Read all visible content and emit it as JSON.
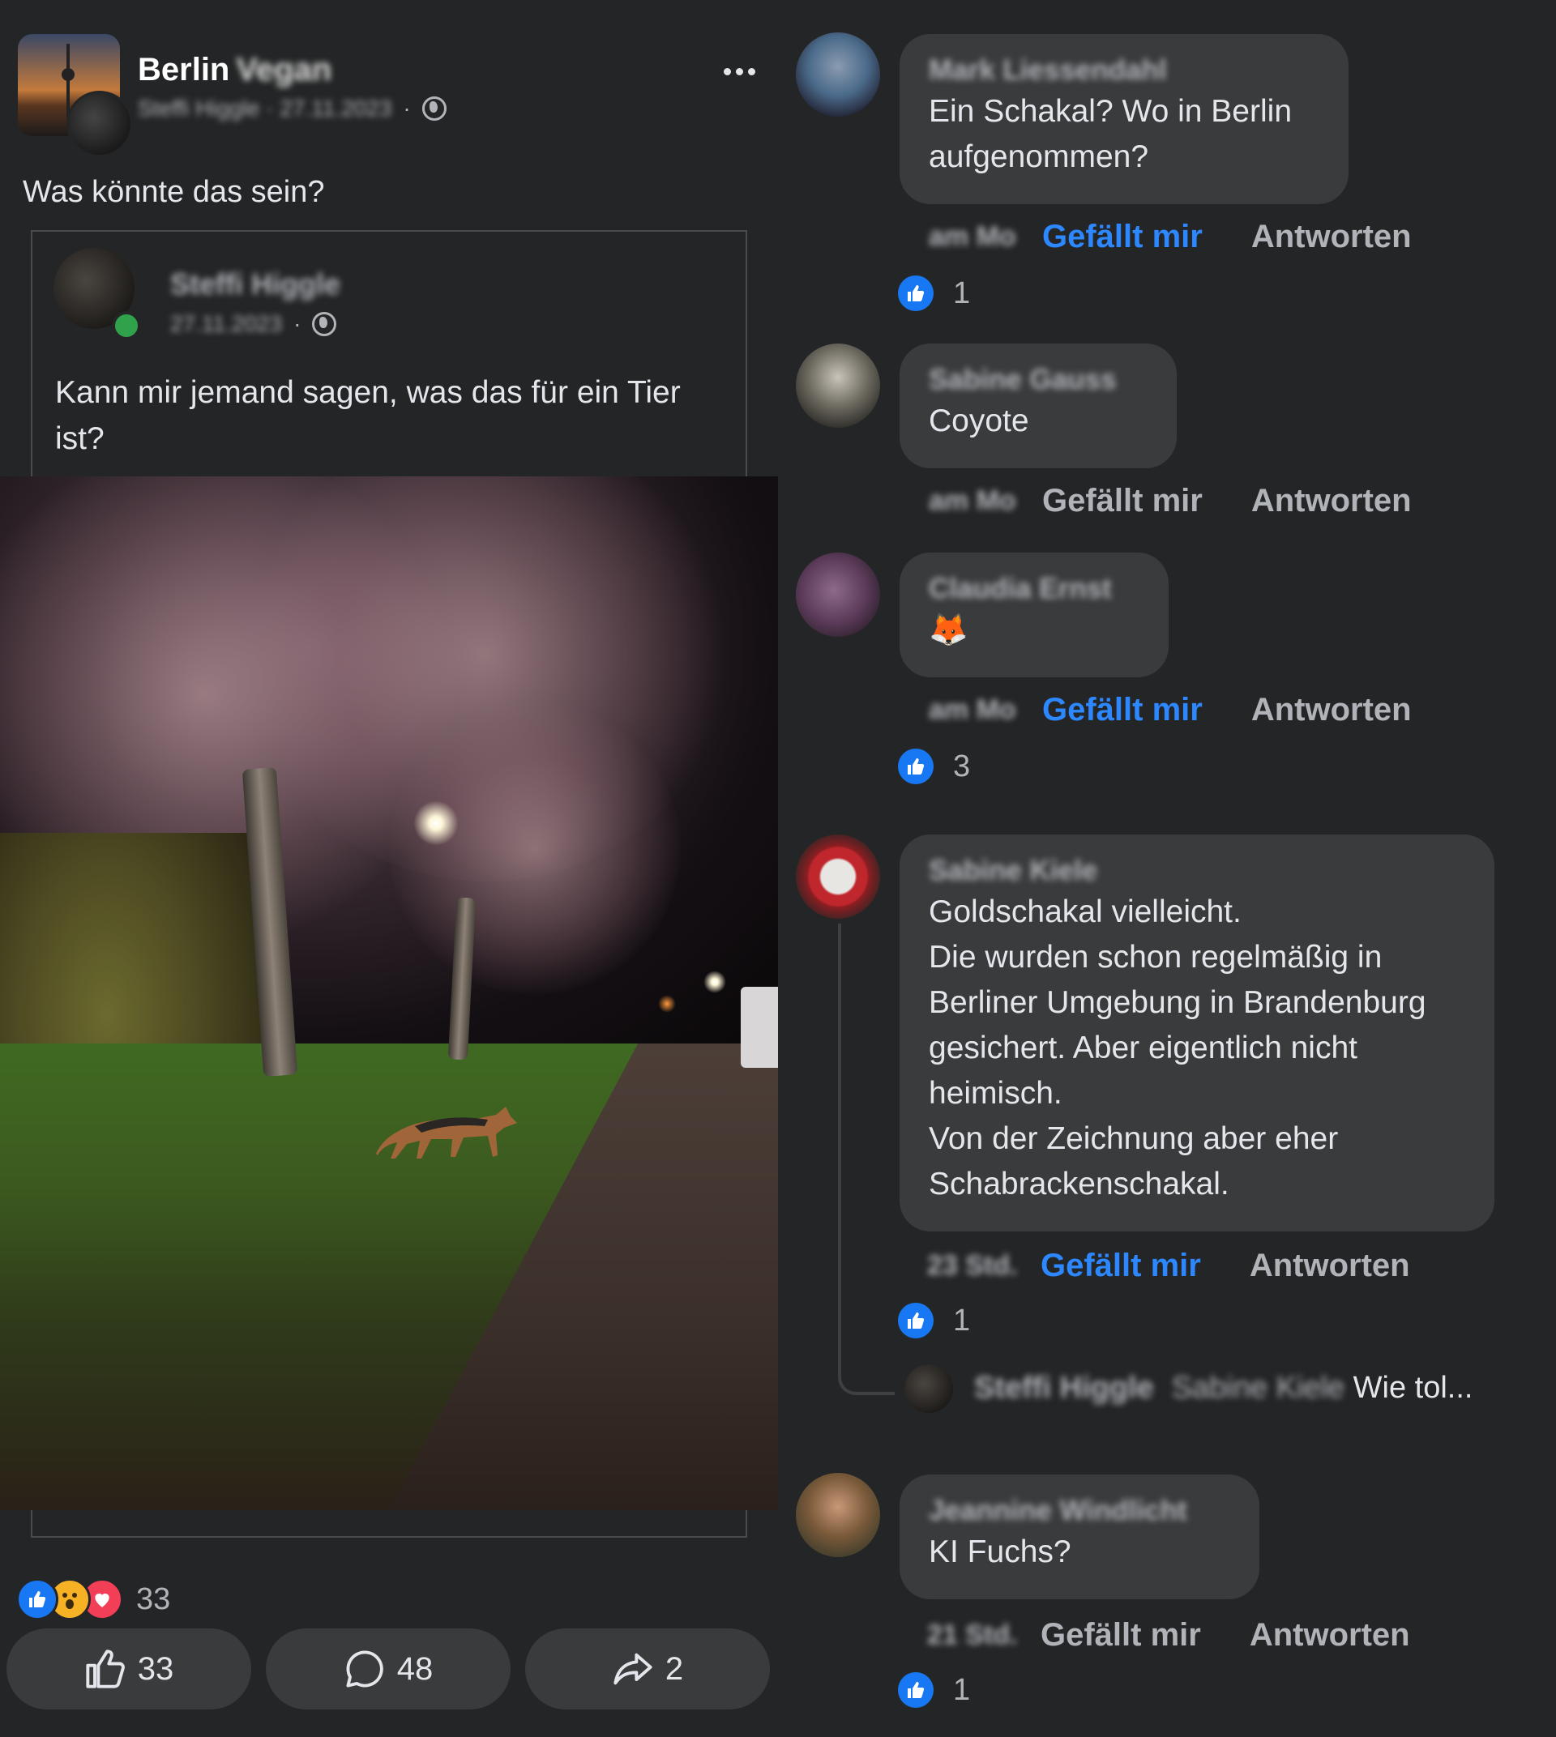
{
  "post": {
    "group_name": "Berlin",
    "group_name_blurred": "Vegan",
    "meta_blurred": "Steffi Higgle · 27.11.2023",
    "meta_dot": "·",
    "text": "Was könnte das sein?",
    "shared": {
      "author_blurred": "Steffi Higgle",
      "date_blurred": "27.11.2023",
      "meta_dot": "·",
      "text": "Kann mir jemand sagen, was das für ein Tier ist?"
    },
    "reactions_count": "33",
    "actions": {
      "like_count": "33",
      "comment_count": "48",
      "share_count": "2"
    }
  },
  "comments": [
    {
      "author_blurred": "Mark Liessendahl",
      "text": "Ein Schakal? Wo in Berlin aufgenommen?",
      "time_blurred": "am Mo",
      "like_label": "Gefällt mir",
      "reply_label": "Antworten",
      "liked": true,
      "likes": "1"
    },
    {
      "author_blurred": "Sabine Gauss",
      "text": "Coyote",
      "time_blurred": "am Mo",
      "like_label": "Gefällt mir",
      "reply_label": "Antworten",
      "liked": false,
      "likes": ""
    },
    {
      "author_blurred": "Claudia Ernst",
      "text": "🦊",
      "time_blurred": "am Mo",
      "like_label": "Gefällt mir",
      "reply_label": "Antworten",
      "liked": true,
      "likes": "3"
    },
    {
      "author_blurred": "Sabine Kiele",
      "text": "Goldschakal vielleicht.\nDie wurden schon regelmäßig in Berliner Umgebung in Brandenburg gesichert. Aber eigentlich nicht heimisch.\nVon der Zeichnung aber eher Schabrackenschakal.",
      "time_blurred": "23 Std.",
      "like_label": "Gefällt mir",
      "reply_label": "Antworten",
      "liked": true,
      "likes": "1",
      "reply_preview": {
        "author_blurred": "Steffi Higgle",
        "mention_blurred": "Sabine Kiele",
        "text": "Wie tol..."
      }
    },
    {
      "author_blurred": "Jeannine Windlicht",
      "text": "KI Fuchs?",
      "time_blurred": "21 Std.",
      "like_label": "Gefällt mir",
      "reply_label": "Antworten",
      "liked": false,
      "likes": "1"
    }
  ],
  "icons": {
    "more": "more-horizontal-icon",
    "globe": "globe-icon",
    "like": "thumbs-up-icon",
    "comment": "comment-icon",
    "share": "share-icon"
  },
  "colors": {
    "background": "#242526",
    "bubble": "#3a3b3c",
    "link_active": "#2d88ff",
    "like_badge": "#1877f2",
    "online": "#31a24c"
  }
}
